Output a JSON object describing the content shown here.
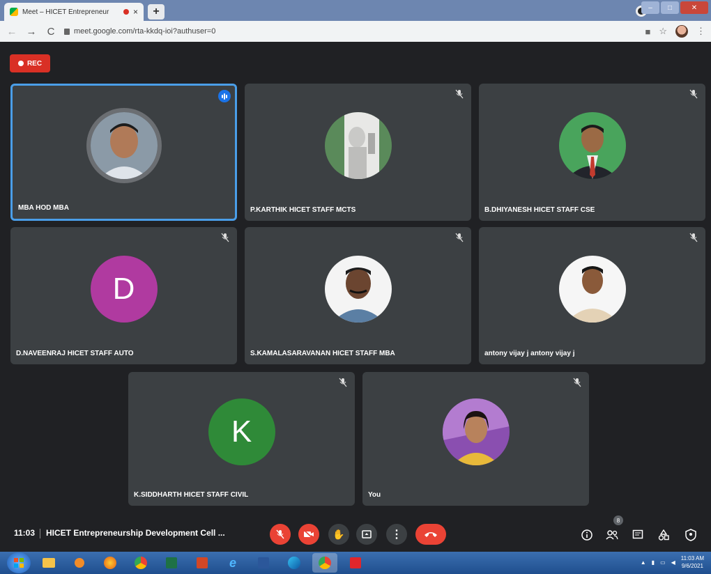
{
  "browser": {
    "tab_title": "Meet – HICET Entrepreneur",
    "new_tab": "+",
    "close_tab": "×",
    "url": "meet.google.com/rta-kkdq-ioi?authuser=0"
  },
  "meet": {
    "rec_label": "REC",
    "tiles": [
      {
        "name": "MBA HOD MBA"
      },
      {
        "name": "P.KARTHIK HICET STAFF MCTS"
      },
      {
        "name": "B.DHIYANESH HICET STAFF CSE"
      },
      {
        "name": "D.NAVEENRAJ HICET STAFF AUTO",
        "letter": "D"
      },
      {
        "name": "S.KAMALASARAVANAN HICET STAFF MBA"
      },
      {
        "name": "antony vijay j antony vijay j"
      },
      {
        "name": "K.SIDDHARTH HICET STAFF CIVIL",
        "letter": "K"
      },
      {
        "name": "You"
      }
    ],
    "colors": {
      "accent": "#1a73e8",
      "danger": "#ea4335",
      "tile_bg": "#3c4043",
      "avatar_d": "#b03aa0",
      "avatar_k": "#2f8a38"
    }
  },
  "bottombar": {
    "time": "11:03",
    "meeting_title": "HICET Entrepreneurship Development Cell ...",
    "participant_count": "8"
  },
  "taskbar": {
    "time": "11:03 AM",
    "date": "9/6/2021"
  }
}
